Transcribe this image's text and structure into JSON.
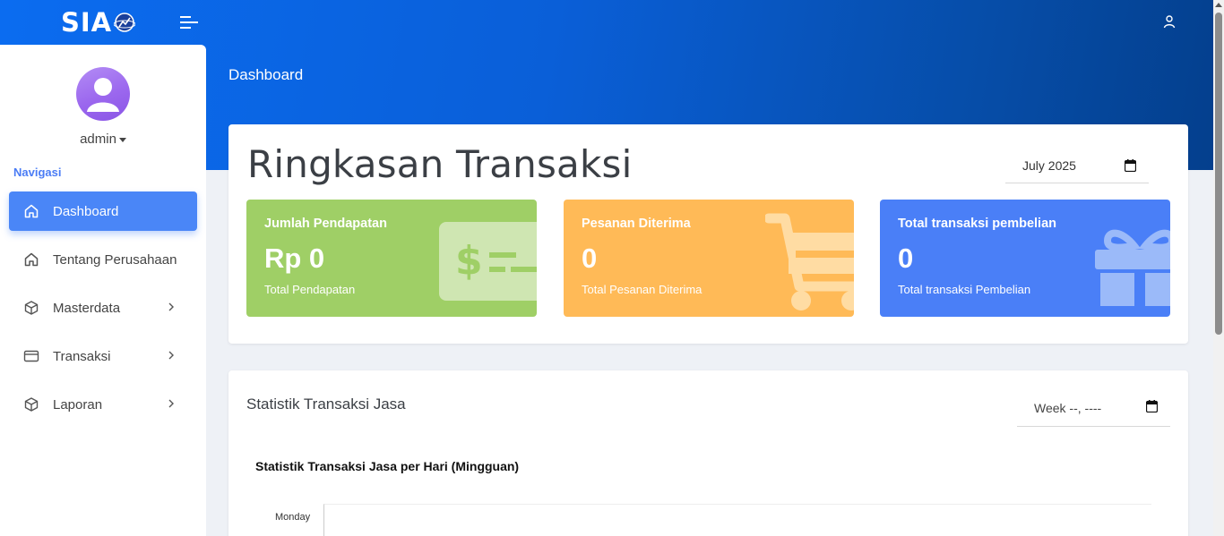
{
  "header": {
    "logo_text": "SIA",
    "menu_toggle_icon": "menu-toggle-icon",
    "user_icon": "user-icon",
    "page_title": "Dashboard"
  },
  "sidebar": {
    "username": "admin",
    "nav_heading": "Navigasi",
    "items": [
      {
        "label": "Dashboard",
        "icon": "home-icon",
        "active": true
      },
      {
        "label": "Tentang Perusahaan",
        "icon": "home-icon"
      },
      {
        "label": "Masterdata",
        "icon": "box-icon",
        "has_submenu": true
      },
      {
        "label": "Transaksi",
        "icon": "credit-card-icon",
        "has_submenu": true
      },
      {
        "label": "Laporan",
        "icon": "box-icon",
        "has_submenu": true
      }
    ]
  },
  "summary": {
    "title": "Ringkasan Transaksi",
    "month_value": "July 2025",
    "cards": [
      {
        "label": "Jumlah Pendapatan",
        "value": "Rp 0",
        "sub": "Total Pendapatan",
        "color": "#9fcf66",
        "icon": "money-icon"
      },
      {
        "label": "Pesanan Diterima",
        "value": "0",
        "sub": "Total Pesanan Diterima",
        "color": "#ffba57",
        "icon": "cart-icon"
      },
      {
        "label": "Total transaksi pembelian",
        "value": "0",
        "sub": "Total transaksi Pembelian",
        "color": "#4a7ff7",
        "icon": "gift-icon"
      }
    ]
  },
  "statistik": {
    "title": "Statistik Transaksi Jasa",
    "week_value": "Week --, ----",
    "chart_title": "Statistik Transaksi Jasa per Hari (Mingguan)",
    "first_day": "Monday"
  },
  "chart_data": {
    "type": "bar",
    "title": "Statistik Transaksi Jasa per Hari (Mingguan)",
    "categories": [
      "Monday"
    ],
    "values": [
      0
    ]
  },
  "colors": {
    "accent": "#4a86f7",
    "header_gradient_start": "#0b6cf0",
    "header_gradient_end": "#043f8d"
  }
}
